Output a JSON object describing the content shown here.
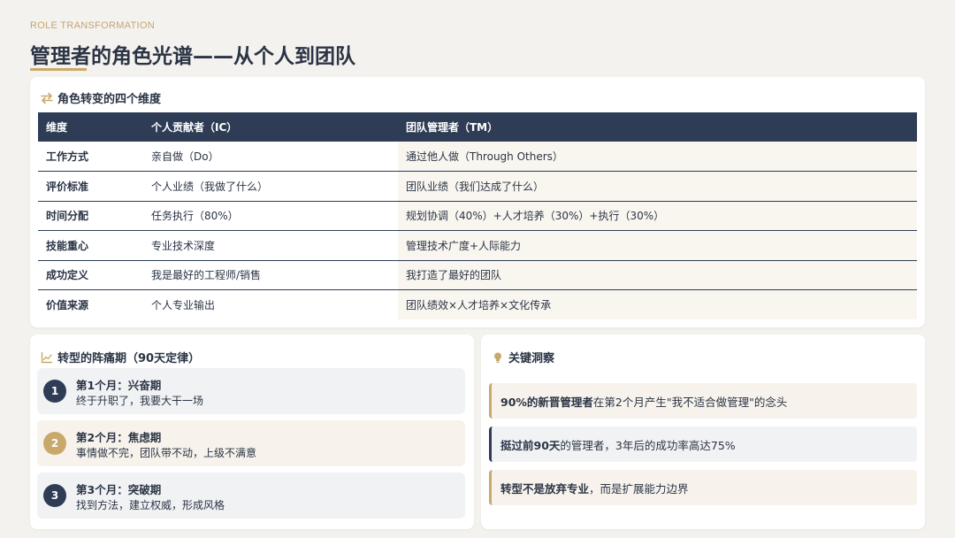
{
  "header": {
    "eyebrow": "ROLE TRANSFORMATION",
    "title": "管理者的角色光谱——从个人到团队"
  },
  "colors": {
    "navy": "#2e3d55",
    "gold": "#c9a96b",
    "background": "#f4f2ee"
  },
  "table_section": {
    "icon": "swap-arrows-icon",
    "title": "角色转变的四个维度",
    "columns": [
      "维度",
      "个人贡献者（IC）",
      "团队管理者（TM）"
    ],
    "rows": [
      [
        "工作方式",
        "亲自做（Do）",
        "通过他人做（Through Others）"
      ],
      [
        "评价标准",
        "个人业绩（我做了什么）",
        "团队业绩（我们达成了什么）"
      ],
      [
        "时间分配",
        "任务执行（80%）",
        "规划协调（40%）+人才培养（30%）+执行（30%）"
      ],
      [
        "技能重心",
        "专业技术深度",
        "管理技术广度+人际能力"
      ],
      [
        "成功定义",
        "我是最好的工程师/销售",
        "我打造了最好的团队"
      ],
      [
        "价值来源",
        "个人专业输出",
        "团队绩效×人才培养×文化传承"
      ]
    ]
  },
  "pain_section": {
    "icon": "line-chart-icon",
    "title": "转型的阵痛期（90天定律）",
    "phases": [
      {
        "num": "1",
        "title": "第1个月：兴奋期",
        "desc": "终于升职了，我要大干一场"
      },
      {
        "num": "2",
        "title": "第2个月：焦虑期",
        "desc": "事情做不完，团队带不动，上级不满意"
      },
      {
        "num": "3",
        "title": "第3个月：突破期",
        "desc": "找到方法，建立权威，形成风格"
      }
    ]
  },
  "insight_section": {
    "icon": "lightbulb-icon",
    "title": "关键洞察",
    "items": [
      {
        "bold": "90%的新晋管理者",
        "rest": "在第2个月产生\"我不适合做管理\"的念头"
      },
      {
        "bold": "挺过前90天",
        "rest": "的管理者，3年后的成功率高达75%"
      },
      {
        "bold": "转型不是放弃专业",
        "rest": "，而是扩展能力边界"
      }
    ]
  }
}
